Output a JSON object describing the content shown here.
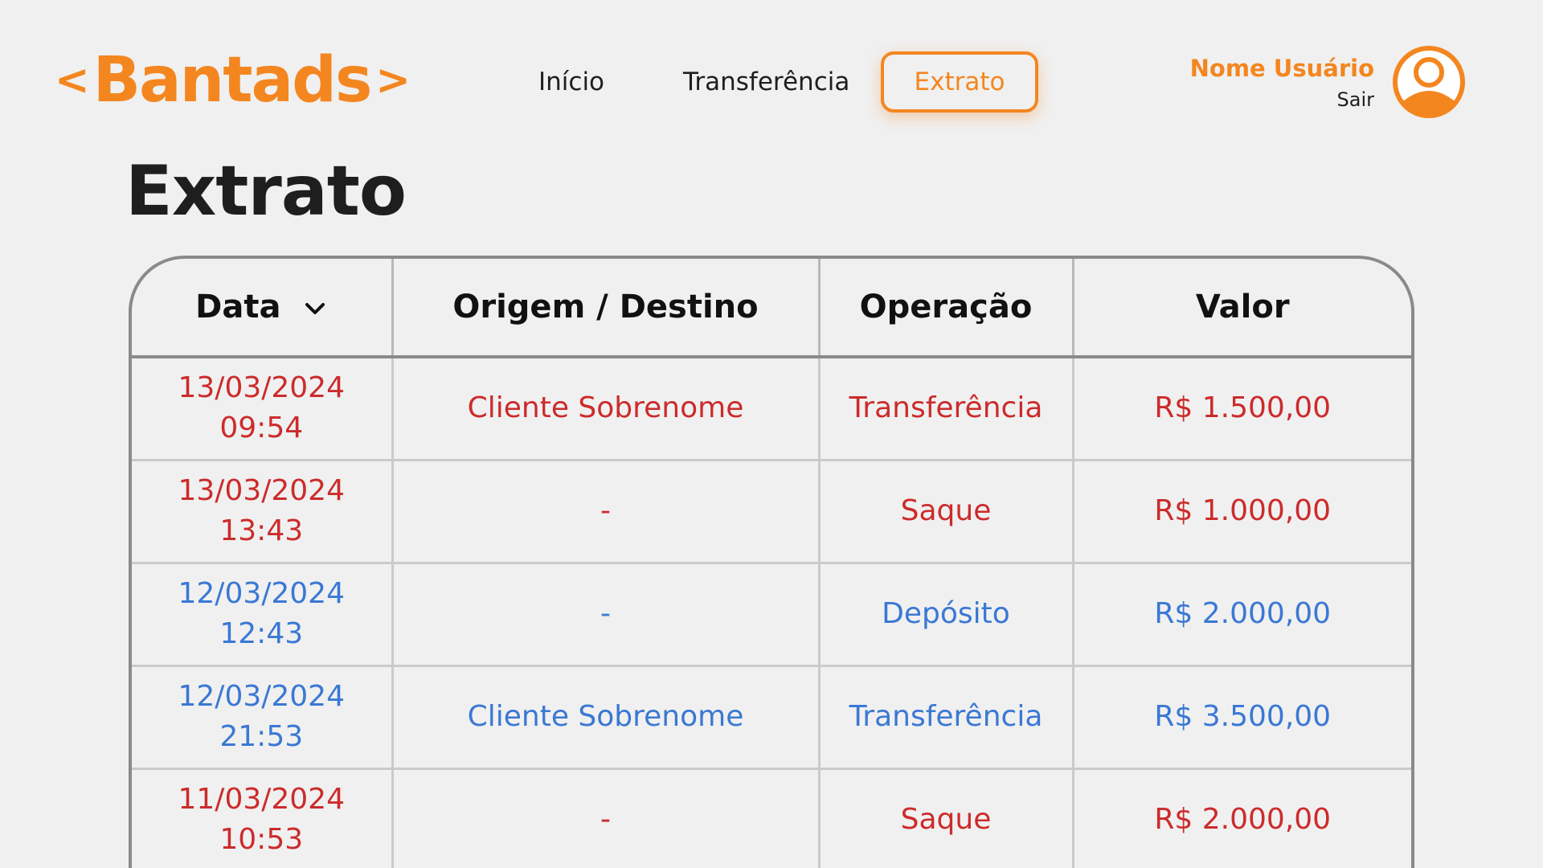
{
  "header": {
    "logo_text": "Bantads",
    "logo_left": "<",
    "logo_right": ">",
    "nav": [
      {
        "label": "Início"
      },
      {
        "label": "Transferência"
      },
      {
        "label": "Extrato",
        "active": true
      }
    ],
    "user_name": "Nome Usuário",
    "logout_label": "Sair"
  },
  "page_title": "Extrato",
  "table": {
    "columns": [
      "Data",
      "Origem / Destino",
      "Operação",
      "Valor"
    ],
    "sort_icon": "chevron-down-icon",
    "rows": [
      {
        "date": "13/03/2024",
        "time": "09:54",
        "party": "Cliente Sobrenome",
        "operation": "Transferência",
        "amount": "R$ 1.500,00",
        "type": "debit"
      },
      {
        "date": "13/03/2024",
        "time": "13:43",
        "party": "-",
        "operation": "Saque",
        "amount": "R$ 1.000,00",
        "type": "debit"
      },
      {
        "date": "12/03/2024",
        "time": "12:43",
        "party": "-",
        "operation": "Depósito",
        "amount": "R$ 2.000,00",
        "type": "credit"
      },
      {
        "date": "12/03/2024",
        "time": "21:53",
        "party": "Cliente Sobrenome",
        "operation": "Transferência",
        "amount": "R$ 3.500,00",
        "type": "credit"
      },
      {
        "date": "11/03/2024",
        "time": "10:53",
        "party": "-",
        "operation": "Saque",
        "amount": "R$ 2.000,00",
        "type": "debit"
      }
    ]
  },
  "colors": {
    "brand": "#f4861f",
    "debit": "#cc2b2b",
    "credit": "#3a78d4",
    "background": "#f0f0f0"
  }
}
